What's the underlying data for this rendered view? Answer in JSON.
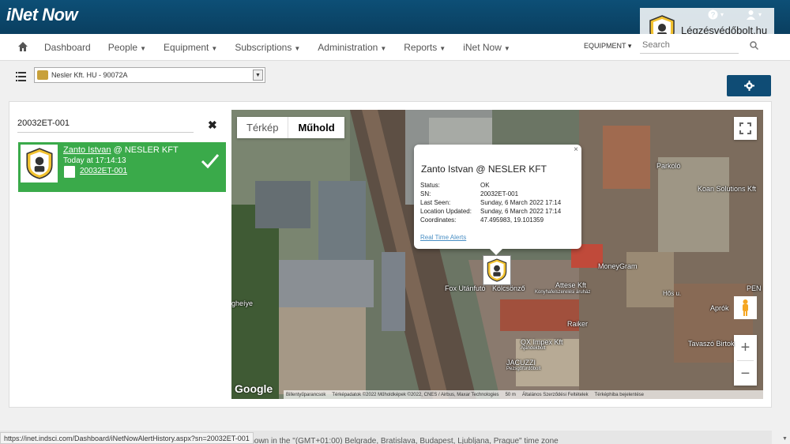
{
  "app": {
    "logo": "iNet Now"
  },
  "top_icons": {
    "help": "?",
    "user": ""
  },
  "ad": {
    "text": "Légzésvédőbolt.hu"
  },
  "nav": {
    "items": [
      "Dashboard",
      "People",
      "Equipment",
      "Subscriptions",
      "Administration",
      "Reports",
      "iNet Now"
    ],
    "equipment_dropdown": "EQUIPMENT",
    "search_placeholder": "Search"
  },
  "company_select": {
    "value": "Nesler Kft. HU - 90072A"
  },
  "search": {
    "value": "20032ET-001"
  },
  "result": {
    "name": "Zanto Istvan",
    "company": " @ NESLER KFT",
    "time": "Today at 17:14:13",
    "sn": "20032ET-001"
  },
  "map": {
    "types": [
      "Térkép",
      "Műhold"
    ],
    "selected_type": "Műhold",
    "labels": [
      "Parkoló",
      "Koan Solutions Kft",
      "MoneyGram",
      "Fox Utánfutó",
      "Kölcsönző",
      "Attese Kft",
      "Konyhafelszerelési áruház",
      "Raiker",
      "QX Impex Kft",
      "Ajándékbolt",
      "JACUZZI",
      "Pezsgőfürdőbolt",
      "Tavaszó Birtok",
      "Hős u.",
      "Aprók",
      "PEN",
      "gheíye"
    ],
    "attribution": [
      "Billentyűparancsok",
      "Térképadatok ©2022 Műholdképek ©2022, CNES / Airbus, Maxar Technologies",
      "50 m",
      "Általános Szerződési Feltételek",
      "Térképhiba bejelentése"
    ],
    "google": "Google"
  },
  "infowindow": {
    "title": "Zanto Istvan @ NESLER KFT",
    "rows": [
      {
        "k": "Status:",
        "v": "OK"
      },
      {
        "k": "SN:",
        "v": "20032ET-001"
      },
      {
        "k": "Last Seen:",
        "v": "Sunday, 6 March 2022 17:14"
      },
      {
        "k": "Location Updated:",
        "v": "Sunday, 6 March 2022 17:14"
      },
      {
        "k": "Coordinates:",
        "v": "47.495983, 19.101359"
      }
    ],
    "link": "Real Time Alerts",
    "close": "×"
  },
  "footer": {
    "timezone_text": "e shown in the \"(GMT+01:00) Belgrade, Bratislava, Budapest, Ljubljana, Prague\" time zone",
    "status_url": "https://inet.indsci.com/Dashboard/iNetNowAlertHistory.aspx?sn=20032ET-001"
  },
  "colors": {
    "topbar": "#0d4f76",
    "card_green": "#3aaa4a",
    "button": "#0f4c75"
  }
}
